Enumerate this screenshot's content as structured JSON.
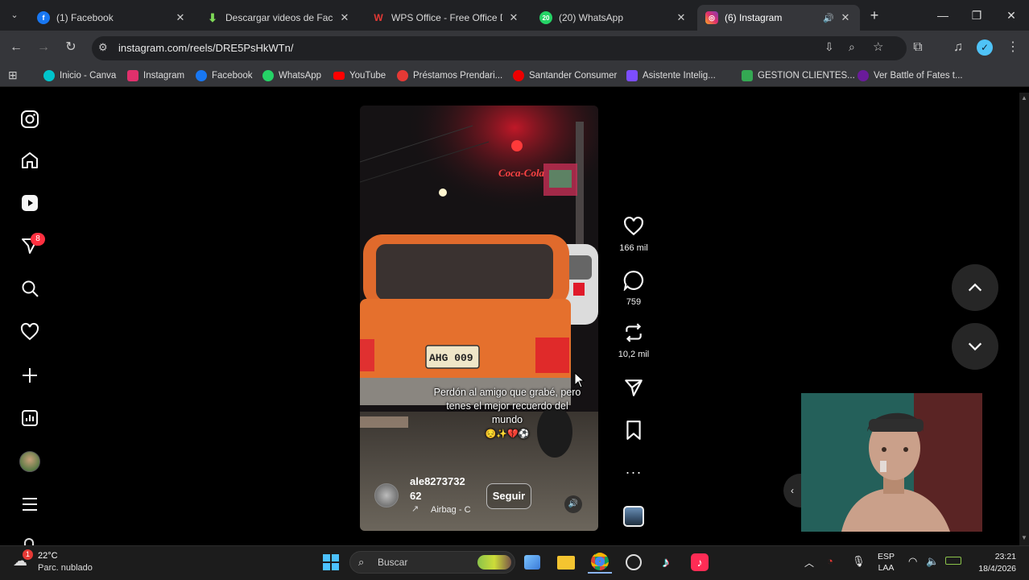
{
  "browser": {
    "tabs": [
      {
        "title": "(1) Facebook",
        "icon": "facebook-icon",
        "color": "#1877f2",
        "badge": "f"
      },
      {
        "title": "Descargar videos de Facebo",
        "icon": "download-icon",
        "color": "#5cb85c",
        "badge": "↓"
      },
      {
        "title": "WPS Office - Free Office Do",
        "icon": "wps-icon",
        "color": "#d52b1e",
        "badge": "W"
      },
      {
        "title": "(20) WhatsApp",
        "icon": "whatsapp-icon",
        "color": "#25d366",
        "badge": "20"
      },
      {
        "title": "(6) Instagram",
        "icon": "instagram-icon",
        "color": "#e1306c",
        "badge": "◎"
      }
    ],
    "url": "instagram.com/reels/DRE5PsHkWTn/",
    "bookmarks": [
      {
        "label": "Inicio - Canva",
        "color": "#00c4cc"
      },
      {
        "label": "Instagram",
        "color": "#e1306c"
      },
      {
        "label": "Facebook",
        "color": "#1877f2"
      },
      {
        "label": "WhatsApp",
        "color": "#25d366"
      },
      {
        "label": "YouTube",
        "color": "#ff0000"
      },
      {
        "label": "Préstamos Prendari...",
        "color": "#e53935"
      },
      {
        "label": "Santander Consumer",
        "color": "#ec0000"
      },
      {
        "label": "Asistente Intelig...",
        "color": "#7c4dff"
      },
      {
        "label": "GESTION CLIENTES...",
        "color": "#34a853"
      },
      {
        "label": "Ver Battle of Fates t...",
        "color": "#6a1b9a"
      }
    ]
  },
  "instagram": {
    "notification_count": "8",
    "reel": {
      "caption": "Perdón al amigo que grabé, pero tenes el mejor recuerdo del mundo",
      "caption_emojis": "😔✨💔⚽",
      "plate": "AHG 009",
      "sign": "Coca-Cola",
      "username_line1": "ale8273732",
      "username_line2": "62",
      "follow_label": "Seguir",
      "audio": "Airbag - C"
    },
    "actions": {
      "likes": "166 mil",
      "comments": "759",
      "reposts": "10,2 mil"
    }
  },
  "taskbar": {
    "temperature": "22°C",
    "weather": "Parc. nublado",
    "weather_badge": "1",
    "search_placeholder": "Buscar",
    "language_top": "ESP",
    "language_bottom": "LAA",
    "time": "23:21",
    "date": "18/4/2026"
  }
}
